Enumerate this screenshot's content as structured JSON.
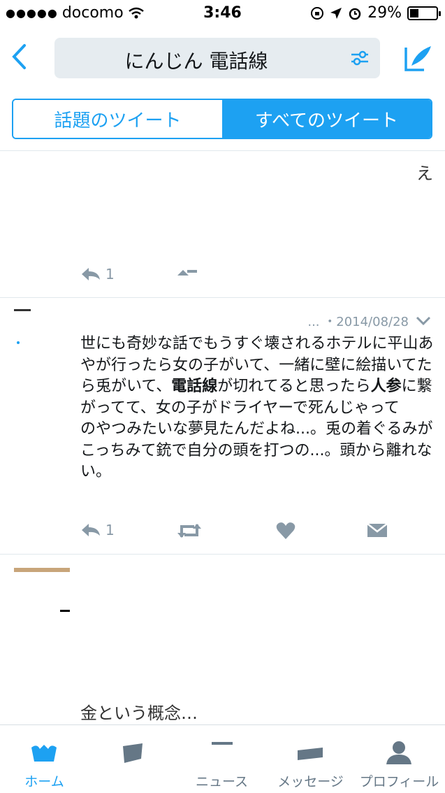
{
  "status_bar": {
    "carrier": "docomo",
    "time": "3:46",
    "battery": "29%"
  },
  "search": {
    "query": "にんじん 電話線"
  },
  "segments": {
    "top": "話題のツイート",
    "all": "すべてのツイート"
  },
  "tweet_prev": {
    "fragment_e": "え",
    "reply_count": "1"
  },
  "tweet_main": {
    "meta": "... ・2014/08/28",
    "text_parts": [
      "世にも奇妙な話でもうすぐ壊されるホテルに平山あやが行ったら女の子がいて、一緒に壁に絵描いてたら兎がいて、",
      "電話線",
      "が切れてると思ったら",
      "人参",
      "に繋がってて、女の子がドライヤーで死んじゃって",
      "のやつみたいな夢見たんだよね...。兎の着ぐるみがこっちみて銃で自分の頭を打つの...。頭から離れない。"
    ],
    "reply_count": "1"
  },
  "tweet_next": {
    "fragment": "金という概念…"
  },
  "tabs": [
    {
      "label": "ホーム",
      "icon": "home-icon"
    },
    {
      "label": "",
      "icon": "notifications-icon"
    },
    {
      "label": "ニュース",
      "icon": "news-icon"
    },
    {
      "label": "メッセージ",
      "icon": "messages-icon"
    },
    {
      "label": "プロフィール",
      "icon": "profile-icon"
    }
  ],
  "colors": {
    "accent": "#1da1f2",
    "muted": "#8899a6",
    "text": "#14171a"
  }
}
